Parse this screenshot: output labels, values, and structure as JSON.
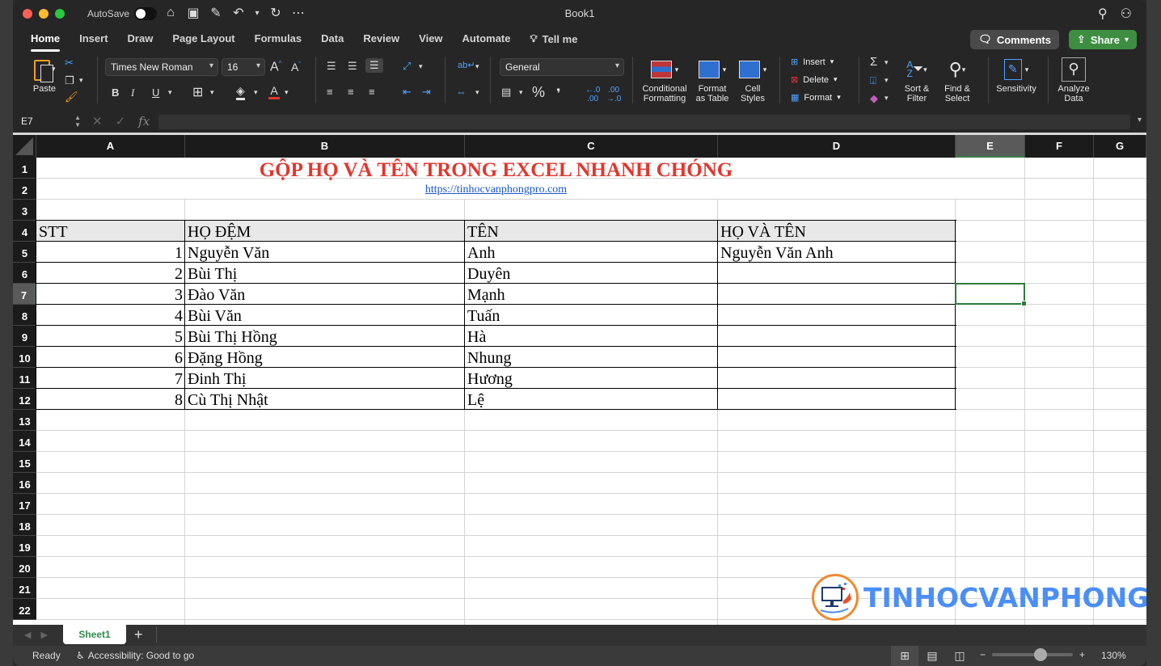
{
  "window": {
    "title": "Book1",
    "autosave_label": "AutoSave",
    "autosave_on": false,
    "traffic_colors": [
      "#ff5f57",
      "#febc2e",
      "#28c840"
    ]
  },
  "quick_access": [
    {
      "name": "home-icon",
      "glyph": "⌂"
    },
    {
      "name": "save-icon",
      "glyph": "🖫"
    },
    {
      "name": "save-as-icon",
      "glyph": "✎"
    },
    {
      "name": "undo-icon",
      "glyph": "↶"
    },
    {
      "name": "undo-dropdown-icon",
      "glyph": "⌄"
    },
    {
      "name": "redo-icon",
      "glyph": "↻"
    },
    {
      "name": "more-icon",
      "glyph": "⋯"
    }
  ],
  "tabs": [
    {
      "label": "Home",
      "active": true
    },
    {
      "label": "Insert"
    },
    {
      "label": "Draw"
    },
    {
      "label": "Page Layout"
    },
    {
      "label": "Formulas"
    },
    {
      "label": "Data"
    },
    {
      "label": "Review"
    },
    {
      "label": "View"
    },
    {
      "label": "Automate"
    }
  ],
  "tell_me": "Tell me",
  "comments_label": "Comments",
  "share_label": "Share",
  "ribbon": {
    "paste_label": "Paste",
    "font_name": "Times New Roman",
    "font_size": "16",
    "number_format": "General",
    "conditional_formatting": [
      "Conditional",
      "Formatting"
    ],
    "format_as_table": [
      "Format",
      "as Table"
    ],
    "cell_styles": [
      "Cell",
      "Styles"
    ],
    "insert_label": "Insert",
    "delete_label": "Delete",
    "format_label": "Format",
    "sort_filter": [
      "Sort &",
      "Filter"
    ],
    "find_select": [
      "Find &",
      "Select"
    ],
    "sensitivity_label": "Sensitivity",
    "analyze_data": [
      "Analyze",
      "Data"
    ],
    "bold": "B",
    "italic": "I",
    "underline": "U",
    "percent": "%",
    "comma": "❜",
    "font_color": "#e2362e",
    "fill_color": "#e0e0e0"
  },
  "formula_bar": {
    "name_box": "E7",
    "fx": "fx",
    "value": ""
  },
  "columns": [
    "A",
    "B",
    "C",
    "D",
    "E",
    "F",
    "G"
  ],
  "selected_column": "E",
  "rows": [
    "1",
    "2",
    "3",
    "4",
    "5",
    "6",
    "7",
    "8",
    "9",
    "10",
    "11",
    "12",
    "13",
    "14",
    "15",
    "16",
    "17",
    "18",
    "19",
    "20",
    "21",
    "22"
  ],
  "selected_row": "7",
  "sheet": {
    "title": "GỘP HỌ VÀ TÊN TRONG EXCEL NHANH CHÓNG",
    "link": "https://tinhocvanphongpro.com",
    "headers": [
      "STT",
      "HỌ ĐỆM",
      "TÊN",
      "HỌ VÀ TÊN"
    ],
    "records": [
      {
        "stt": "1",
        "ho_dem": "Nguyễn Văn",
        "ten": "Anh",
        "ho_va_ten": "Nguyễn Văn Anh"
      },
      {
        "stt": "2",
        "ho_dem": "Bùi Thị",
        "ten": "Duyên",
        "ho_va_ten": ""
      },
      {
        "stt": "3",
        "ho_dem": "Đào Văn",
        "ten": "Mạnh",
        "ho_va_ten": ""
      },
      {
        "stt": "4",
        "ho_dem": "Bùi Văn",
        "ten": "Tuấn",
        "ho_va_ten": ""
      },
      {
        "stt": "5",
        "ho_dem": "Bùi Thị Hồng",
        "ten": "Hà",
        "ho_va_ten": ""
      },
      {
        "stt": "6",
        "ho_dem": "Đặng Hồng",
        "ten": "Nhung",
        "ho_va_ten": ""
      },
      {
        "stt": "7",
        "ho_dem": "Đinh Thị",
        "ten": "Hương",
        "ho_va_ten": ""
      },
      {
        "stt": "8",
        "ho_dem": "Cù Thị Nhật",
        "ten": "Lệ",
        "ho_va_ten": ""
      }
    ],
    "title_color": "#e2362e",
    "link_color": "#1a56c9",
    "header_fill": "#e8e8e8"
  },
  "watermark": "TINHOCVANPHONG",
  "sheet_tabs": [
    {
      "label": "Sheet1",
      "active": true
    }
  ],
  "status": {
    "ready": "Ready",
    "accessibility": "Accessibility: Good to go",
    "zoom": "130%",
    "zoom_fraction": 0.6
  }
}
